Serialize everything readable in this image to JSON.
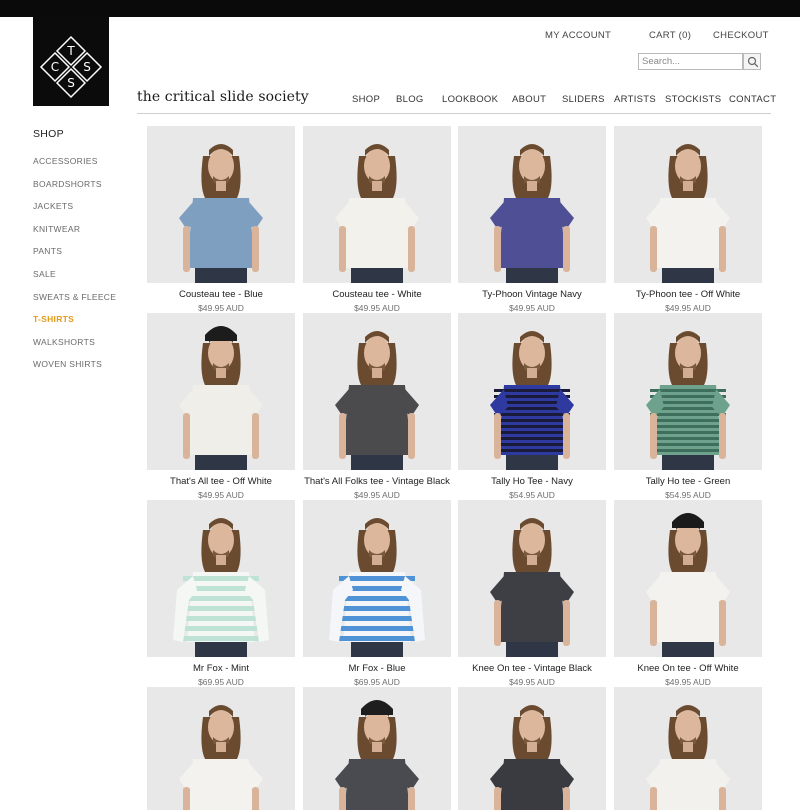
{
  "brand": {
    "logo_letters": [
      "T",
      "C",
      "S",
      "S"
    ],
    "name": "the critical slide society"
  },
  "header": {
    "my_account": "MY ACCOUNT",
    "cart": "CART (0)",
    "checkout": "CHECKOUT",
    "search_placeholder": "Search...",
    "nav": [
      "SHOP",
      "BLOG",
      "LOOKBOOK",
      "ABOUT",
      "SLIDERS",
      "ARTISTS",
      "STOCKISTS",
      "CONTACT"
    ]
  },
  "sidebar": {
    "title": "SHOP",
    "items": [
      {
        "label": "ACCESSORIES",
        "active": false
      },
      {
        "label": "BOARDSHORTS",
        "active": false
      },
      {
        "label": "JACKETS",
        "active": false
      },
      {
        "label": "KNITWEAR",
        "active": false
      },
      {
        "label": "PANTS",
        "active": false
      },
      {
        "label": "SALE",
        "active": false
      },
      {
        "label": "SWEATS & FLEECE",
        "active": false
      },
      {
        "label": "T-SHIRTS",
        "active": true
      },
      {
        "label": "WALKSHORTS",
        "active": false
      },
      {
        "label": "WOVEN SHIRTS",
        "active": false
      }
    ]
  },
  "colors": {
    "accent": "#e29b1a",
    "topbar": "#0a0a0a"
  },
  "products": [
    {
      "name": "Cousteau tee - Blue",
      "price": "$49.95 AUD",
      "shirt": "#7e9fbf",
      "sleeve": "short",
      "stripe": null,
      "beanie": null
    },
    {
      "name": "Cousteau tee - White",
      "price": "$49.95 AUD",
      "shirt": "#f2f1ec",
      "sleeve": "short",
      "stripe": null,
      "beanie": null
    },
    {
      "name": "Ty-Phoon Vintage Navy",
      "price": "$49.95 AUD",
      "shirt": "#4e4f95",
      "sleeve": "short",
      "stripe": null,
      "beanie": null
    },
    {
      "name": "Ty-Phoon tee - Off White",
      "price": "$49.95 AUD",
      "shirt": "#f3f2ee",
      "sleeve": "short",
      "stripe": null,
      "beanie": null
    },
    {
      "name": "That's All tee - Off White",
      "price": "$49.95 AUD",
      "shirt": "#efeee8",
      "sleeve": "short",
      "stripe": null,
      "beanie": "#1c1c1c"
    },
    {
      "name": "That's All Folks tee - Vintage Black",
      "price": "$49.95 AUD",
      "shirt": "#4b4b4d",
      "sleeve": "short",
      "stripe": null,
      "beanie": null
    },
    {
      "name": "Tally Ho Tee - Navy",
      "price": "$54.95 AUD",
      "shirt": "#2f3aa0",
      "sleeve": "short",
      "stripe": "#1a1a3a",
      "beanie": null
    },
    {
      "name": "Tally Ho tee - Green",
      "price": "$54.95 AUD",
      "shirt": "#6fa28d",
      "sleeve": "short",
      "stripe": "#3d6f5c",
      "beanie": null
    },
    {
      "name": "Mr Fox - Mint",
      "price": "$69.95 AUD",
      "shirt": "#f4f7f4",
      "sleeve": "long",
      "stripe": "#bfe2d6",
      "beanie": null
    },
    {
      "name": "Mr Fox - Blue",
      "price": "$69.95 AUD",
      "shirt": "#f4f6fa",
      "sleeve": "long",
      "stripe": "#4f92d6",
      "beanie": null
    },
    {
      "name": "Knee On tee - Vintage Black",
      "price": "$49.95 AUD",
      "shirt": "#3e3f45",
      "sleeve": "short",
      "stripe": null,
      "beanie": null
    },
    {
      "name": "Knee On tee - Off White",
      "price": "$49.95 AUD",
      "shirt": "#f3f2ee",
      "sleeve": "short",
      "stripe": null,
      "beanie": "#1a1a1a"
    },
    {
      "name": "",
      "price": "",
      "shirt": "#f3f2ee",
      "sleeve": "short",
      "stripe": null,
      "beanie": null
    },
    {
      "name": "",
      "price": "",
      "shirt": "#4a4b50",
      "sleeve": "short",
      "stripe": null,
      "beanie": "#1e1e1e"
    },
    {
      "name": "",
      "price": "",
      "shirt": "#3a3b41",
      "sleeve": "short",
      "stripe": null,
      "beanie": null
    },
    {
      "name": "",
      "price": "",
      "shirt": "#f2f1ed",
      "sleeve": "short",
      "stripe": null,
      "beanie": null
    }
  ]
}
